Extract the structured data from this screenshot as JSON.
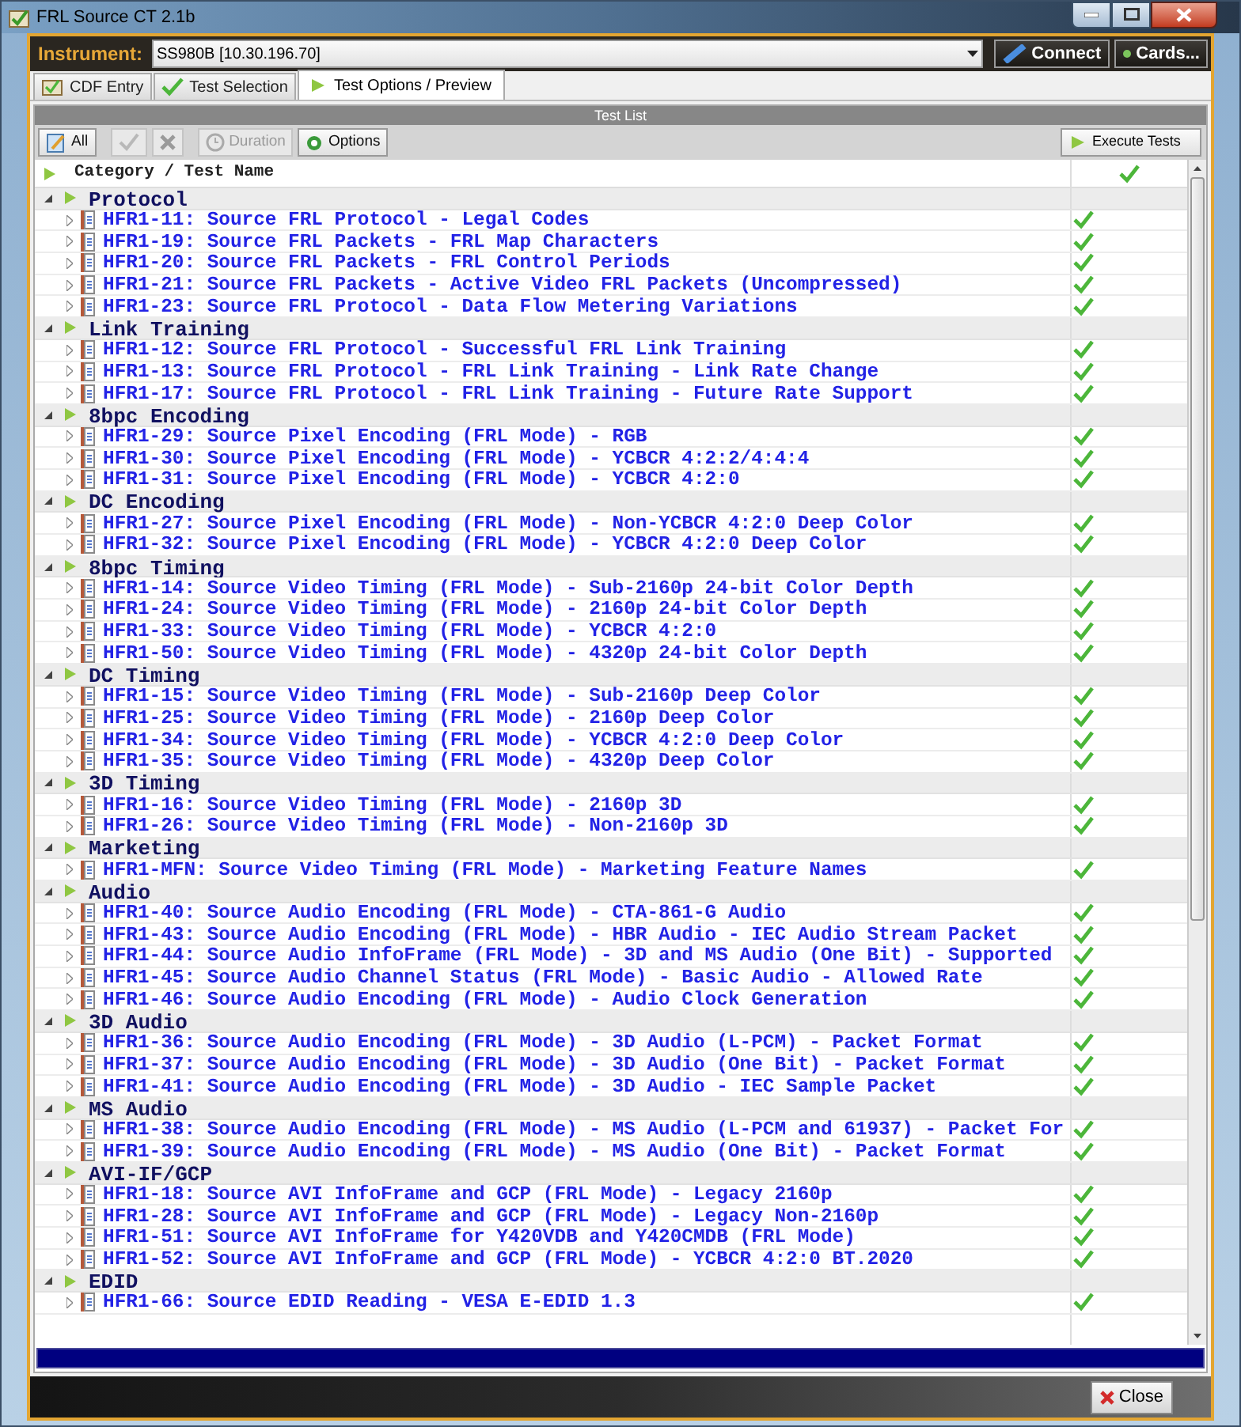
{
  "window": {
    "title": "FRL Source CT 2.1b"
  },
  "instrument": {
    "label": "Instrument:",
    "value": "SS980B [10.30.196.70]",
    "buttons": [
      "Connect",
      "Cards..."
    ]
  },
  "tabs": [
    {
      "label": "CDF Entry",
      "selected": false
    },
    {
      "label": "Test Selection",
      "selected": false
    },
    {
      "label": "Test Options / Preview",
      "selected": true
    }
  ],
  "test_list": {
    "title": "Test List",
    "toolbar": [
      {
        "kind": "all",
        "label": "All",
        "disabled": false
      },
      {
        "kind": "check",
        "disabled": true
      },
      {
        "kind": "clear",
        "disabled": true
      },
      {
        "kind": "duration",
        "label": "Duration",
        "disabled": true
      },
      {
        "kind": "options",
        "label": "Options",
        "disabled": false
      }
    ],
    "execute_button": "Execute Tests",
    "header": {
      "label": "Category / Test Name",
      "checked": true
    },
    "categories": [
      {
        "name": "Protocol",
        "expanded": true,
        "tests": [
          {
            "name": "HFR1-11: Source FRL Protocol - Legal Codes",
            "checked": true
          },
          {
            "name": "HFR1-19: Source FRL Packets - FRL Map Characters",
            "checked": true
          },
          {
            "name": "HFR1-20: Source FRL Packets - FRL Control Periods",
            "checked": true
          },
          {
            "name": "HFR1-21: Source FRL Packets - Active Video FRL Packets (Uncompressed)",
            "checked": true
          },
          {
            "name": "HFR1-23: Source FRL Protocol - Data Flow Metering Variations",
            "checked": true
          }
        ]
      },
      {
        "name": "Link Training",
        "expanded": true,
        "tests": [
          {
            "name": "HFR1-12: Source FRL Protocol - Successful FRL Link Training",
            "checked": true
          },
          {
            "name": "HFR1-13: Source FRL Protocol - FRL Link Training - Link Rate Change",
            "checked": true
          },
          {
            "name": "HFR1-17: Source FRL Protocol - FRL Link Training - Future Rate Support",
            "checked": true
          }
        ]
      },
      {
        "name": "8bpc Encoding",
        "expanded": true,
        "tests": [
          {
            "name": "HFR1-29: Source Pixel Encoding (FRL Mode) - RGB",
            "checked": true
          },
          {
            "name": "HFR1-30: Source Pixel Encoding (FRL Mode) - YCBCR 4:2:2/4:4:4",
            "checked": true
          },
          {
            "name": "HFR1-31: Source Pixel Encoding (FRL Mode) - YCBCR 4:2:0",
            "checked": true
          }
        ]
      },
      {
        "name": "DC Encoding",
        "expanded": true,
        "tests": [
          {
            "name": "HFR1-27: Source Pixel Encoding (FRL Mode) - Non-YCBCR 4:2:0 Deep Color",
            "checked": true
          },
          {
            "name": "HFR1-32: Source Pixel Encoding (FRL Mode) - YCBCR 4:2:0 Deep Color",
            "checked": true
          }
        ]
      },
      {
        "name": "8bpc Timing",
        "expanded": true,
        "tests": [
          {
            "name": "HFR1-14: Source Video Timing (FRL Mode) - Sub-2160p 24-bit Color Depth",
            "checked": true
          },
          {
            "name": "HFR1-24: Source Video Timing (FRL Mode) - 2160p 24-bit Color Depth",
            "checked": true
          },
          {
            "name": "HFR1-33: Source Video Timing (FRL Mode) - YCBCR 4:2:0",
            "checked": true
          },
          {
            "name": "HFR1-50: Source Video Timing (FRL Mode) - 4320p 24-bit Color Depth",
            "checked": true
          }
        ]
      },
      {
        "name": "DC Timing",
        "expanded": true,
        "tests": [
          {
            "name": "HFR1-15: Source Video Timing (FRL Mode) - Sub-2160p Deep Color",
            "checked": true
          },
          {
            "name": "HFR1-25: Source Video Timing (FRL Mode) - 2160p Deep Color",
            "checked": true
          },
          {
            "name": "HFR1-34: Source Video Timing (FRL Mode) - YCBCR 4:2:0 Deep Color",
            "checked": true
          },
          {
            "name": "HFR1-35: Source Video Timing (FRL Mode) - 4320p Deep Color",
            "checked": true
          }
        ]
      },
      {
        "name": "3D Timing",
        "expanded": true,
        "tests": [
          {
            "name": "HFR1-16: Source Video Timing (FRL Mode) - 2160p 3D",
            "checked": true
          },
          {
            "name": "HFR1-26: Source Video Timing (FRL Mode) - Non-2160p 3D",
            "checked": true
          }
        ]
      },
      {
        "name": "Marketing",
        "expanded": true,
        "tests": [
          {
            "name": "HFR1-MFN: Source Video Timing (FRL Mode) - Marketing Feature Names",
            "checked": true
          }
        ]
      },
      {
        "name": "Audio",
        "expanded": true,
        "tests": [
          {
            "name": "HFR1-40: Source Audio Encoding (FRL Mode) - CTA-861-G Audio",
            "checked": true
          },
          {
            "name": "HFR1-43: Source Audio Encoding (FRL Mode) - HBR Audio - IEC Audio Stream Packet",
            "checked": true
          },
          {
            "name": "HFR1-44: Source Audio InfoFrame (FRL Mode) - 3D and MS Audio (One Bit) - Supported",
            "checked": true
          },
          {
            "name": "HFR1-45: Source Audio Channel Status (FRL Mode) - Basic Audio - Allowed Rate",
            "checked": true
          },
          {
            "name": "HFR1-46: Source Audio Encoding (FRL Mode) - Audio Clock Generation",
            "checked": true
          }
        ]
      },
      {
        "name": "3D Audio",
        "expanded": true,
        "tests": [
          {
            "name": "HFR1-36: Source Audio Encoding (FRL Mode) - 3D Audio (L-PCM) - Packet Format",
            "checked": true
          },
          {
            "name": "HFR1-37: Source Audio Encoding (FRL Mode) - 3D Audio (One Bit) - Packet Format",
            "checked": true
          },
          {
            "name": "HFR1-41: Source Audio Encoding (FRL Mode) - 3D Audio - IEC Sample Packet",
            "checked": true
          }
        ]
      },
      {
        "name": "MS Audio",
        "expanded": true,
        "tests": [
          {
            "name": "HFR1-38: Source Audio Encoding (FRL Mode) - MS Audio (L-PCM and 61937) - Packet For",
            "checked": true
          },
          {
            "name": "HFR1-39: Source Audio Encoding (FRL Mode) - MS Audio (One Bit) - Packet Format",
            "checked": true
          }
        ]
      },
      {
        "name": "AVI-IF/GCP",
        "expanded": true,
        "tests": [
          {
            "name": "HFR1-18: Source AVI InfoFrame and GCP (FRL Mode) - Legacy 2160p",
            "checked": true
          },
          {
            "name": "HFR1-28: Source AVI InfoFrame and GCP (FRL Mode) - Legacy Non-2160p",
            "checked": true
          },
          {
            "name": "HFR1-51: Source AVI InfoFrame for Y420VDB and Y420CMDB (FRL Mode)",
            "checked": true
          },
          {
            "name": "HFR1-52: Source AVI InfoFrame and GCP (FRL Mode) - YCBCR 4:2:0 BT.2020",
            "checked": true
          }
        ]
      },
      {
        "name": "EDID",
        "expanded": true,
        "tests": [
          {
            "name": "HFR1-66: Source EDID Reading - VESA E-EDID 1.3",
            "checked": true
          }
        ]
      }
    ]
  },
  "progress": {
    "level": 1
  },
  "close_button": "Close"
}
